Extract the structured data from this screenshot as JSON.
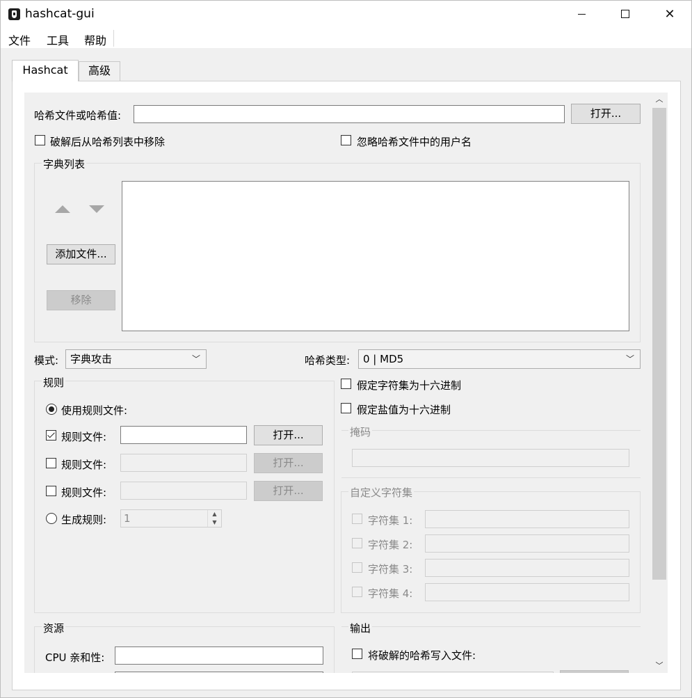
{
  "window": {
    "title": "hashcat-gui",
    "minimize": "–",
    "maximize": "□",
    "close": "✕"
  },
  "menu": {
    "file": "文件",
    "tools": "工具",
    "help": "帮助"
  },
  "tabs": {
    "hashcat": "Hashcat",
    "advanced": "高级"
  },
  "hash_input": {
    "label": "哈希文件或哈希值:",
    "value": "",
    "open_button": "打开..."
  },
  "options": {
    "remove_cracked": {
      "label": "破解后从哈希列表中移除",
      "checked": false
    },
    "ignore_usernames": {
      "label": "忽略哈希文件中的用户名",
      "checked": false
    }
  },
  "wordlist": {
    "title": "字典列表",
    "add_button": "添加文件...",
    "remove_button": "移除",
    "items": []
  },
  "mode": {
    "label": "模式:",
    "selected": "字典攻击"
  },
  "hash_type": {
    "label": "哈希类型:",
    "selected": "0 | MD5"
  },
  "rules": {
    "title": "规则",
    "use_rule_files": "使用规则文件:",
    "rule_file_label": "规则文件:",
    "rows": [
      {
        "label": "规则文件:",
        "checked": true,
        "enabled": true,
        "open": "打开..."
      },
      {
        "label": "规则文件:",
        "checked": false,
        "enabled": false,
        "open": "打开..."
      },
      {
        "label": "规则文件:",
        "checked": false,
        "enabled": false,
        "open": "打开..."
      }
    ],
    "generate_label": "生成规则:",
    "generate_value": "1"
  },
  "charset": {
    "hex_charset": "假定字符集为十六进制",
    "hex_salt": "假定盐值为十六进制",
    "mask_title": "掩码",
    "custom_title": "自定义字符集",
    "sets": [
      "字符集 1:",
      "字符集 2:",
      "字符集 3:",
      "字符集 4:"
    ]
  },
  "resources": {
    "title": "资源",
    "cpu_affinity_label": "CPU 亲和性:"
  },
  "output": {
    "title": "输出",
    "write_cracked": "将破解的哈希写入文件:"
  },
  "scrollbar": {
    "up": "︿",
    "down": "﹀"
  }
}
